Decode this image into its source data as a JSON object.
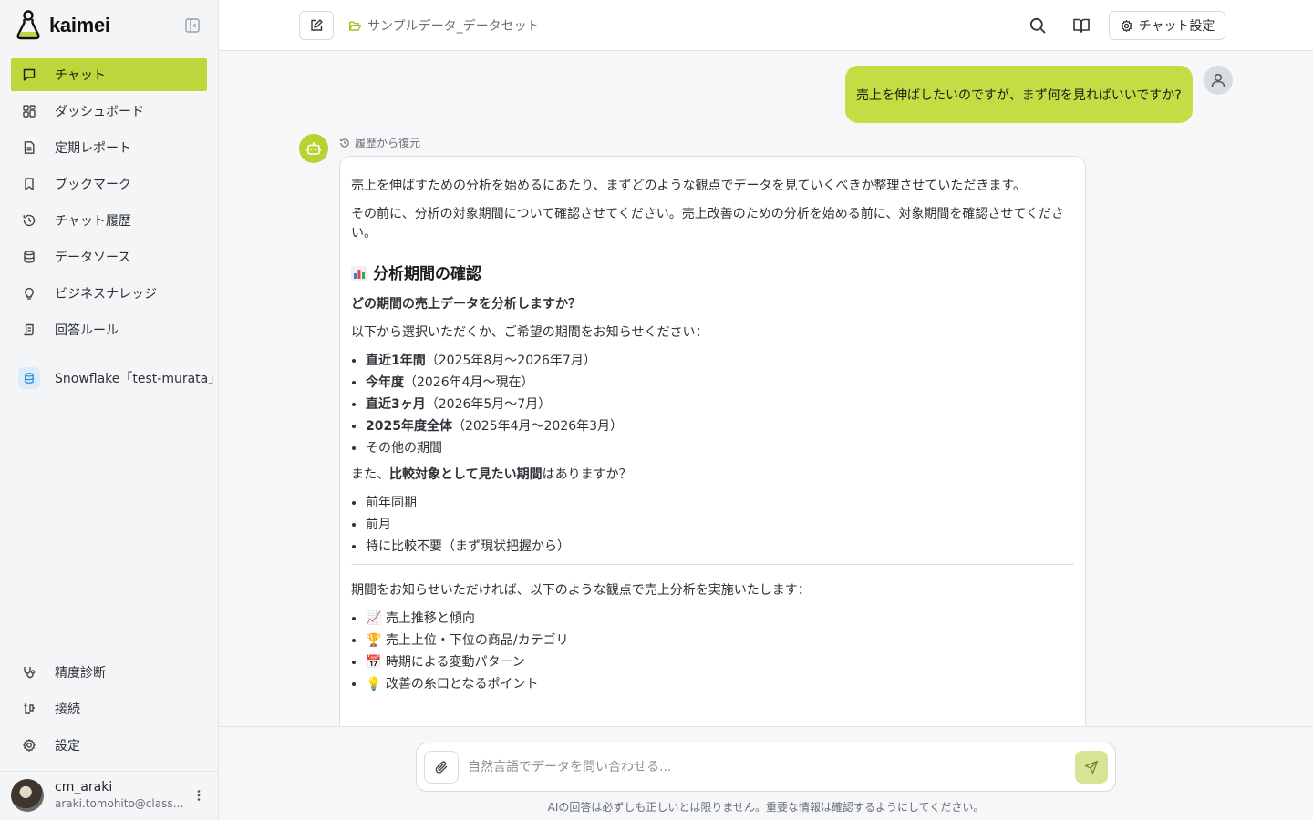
{
  "brand": {
    "name": "kaimei"
  },
  "sidebar": {
    "items": [
      {
        "label": "チャット",
        "icon": "chat-icon",
        "active": true
      },
      {
        "label": "ダッシュボード",
        "icon": "dashboard-icon"
      },
      {
        "label": "定期レポート",
        "icon": "report-icon"
      },
      {
        "label": "ブックマーク",
        "icon": "bookmark-icon"
      },
      {
        "label": "チャット履歴",
        "icon": "history-icon"
      },
      {
        "label": "データソース",
        "icon": "database-icon"
      },
      {
        "label": "ビジネスナレッジ",
        "icon": "lightbulb-icon"
      },
      {
        "label": "回答ルール",
        "icon": "rules-icon"
      }
    ],
    "datasource": {
      "label": "Snowflake「test-murata」",
      "icon": "snowflake-db-icon"
    },
    "bottom_items": [
      {
        "label": "精度診断",
        "icon": "stethoscope-icon"
      },
      {
        "label": "接続",
        "icon": "connection-icon"
      },
      {
        "label": "設定",
        "icon": "gear-icon"
      }
    ],
    "user": {
      "name": "cm_araki",
      "email": "araki.tomohito@classmethod.jp"
    }
  },
  "header": {
    "dataset": "サンプルデータ_データセット",
    "settings_label": "チャット設定"
  },
  "chat": {
    "user_message": "売上を伸ばしたいのですが、まず何を見ればいいですか?",
    "restore_label": "履歴から復元",
    "bot": {
      "p1": "売上を伸ばすための分析を始めるにあたり、まずどのような観点でデータを見ていくべきか整理させていただきます。",
      "p2": "その前に、分析の対象期間について確認させてください。売上改善のための分析を始める前に、対象期間を確認させてください。",
      "h1": "分析期間の確認",
      "q1": "どの期間の売上データを分析しますか？",
      "p3": "以下から選択いただくか、ご希望の期間をお知らせください：",
      "periods": [
        {
          "bold": "直近1年間",
          "text": "（2025年8月〜2026年7月）"
        },
        {
          "bold": "今年度",
          "text": "（2026年4月〜現在）"
        },
        {
          "bold": "直近3ヶ月",
          "text": "（2026年5月〜7月）"
        },
        {
          "bold": "2025年度全体",
          "text": "（2025年4月〜2026年3月）"
        },
        {
          "bold": "",
          "text": "その他の期間"
        }
      ],
      "p4_pre": "また、",
      "p4_bold": "比較対象として見たい期間",
      "p4_post": "はありますか？",
      "compare": [
        "前年同期",
        "前月",
        "特に比較不要（まず現状把握から）"
      ],
      "p5": "期間をお知らせいただければ、以下のような観点で売上分析を実施いたします：",
      "perspectives": [
        {
          "emoji": "📈",
          "text": "売上推移と傾向"
        },
        {
          "emoji": "🏆",
          "text": "売上上位・下位の商品/カテゴリ"
        },
        {
          "emoji": "📅",
          "text": "時期による変動パターン"
        },
        {
          "emoji": "💡",
          "text": "改善の糸口となるポイント"
        }
      ]
    }
  },
  "composer": {
    "placeholder": "自然言語でデータを問い合わせる...",
    "disclaimer": "AIの回答は必ずしも正しいとは限りません。重要な情報は確認するようにしてください。"
  },
  "colors": {
    "accent": "#bed63c",
    "bubble": "#c6dc45",
    "bot_avatar": "#b9d131"
  }
}
